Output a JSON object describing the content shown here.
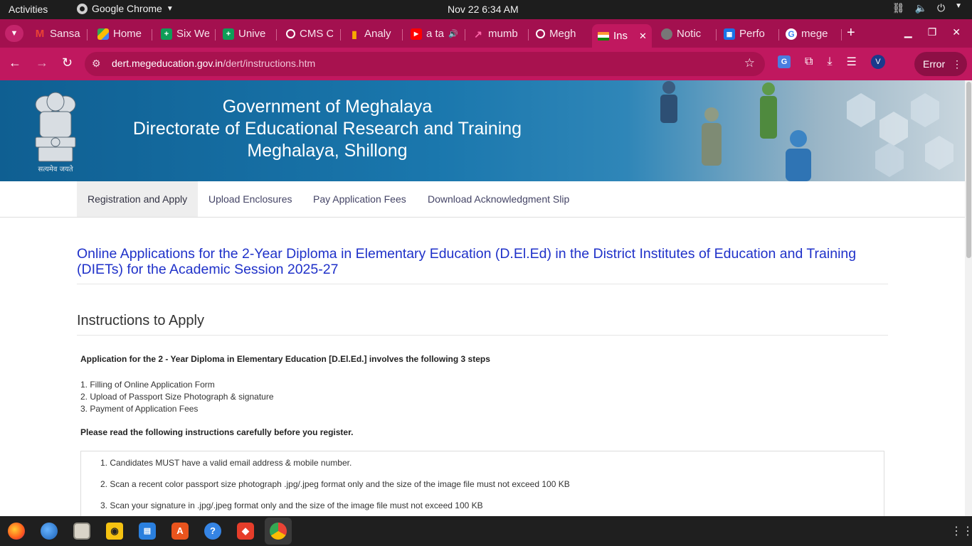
{
  "system_bar": {
    "activities": "Activities",
    "app_name": "Google Chrome",
    "clock": "Nov 22  6:34 AM"
  },
  "tabs": [
    {
      "label": "Sansa",
      "icon": "gmail-icon"
    },
    {
      "label": "Home",
      "icon": "drive-icon"
    },
    {
      "label": "Six We",
      "icon": "sheets-icon"
    },
    {
      "label": "Unive",
      "icon": "sheets-icon"
    },
    {
      "label": "CMS C",
      "icon": "loading-icon"
    },
    {
      "label": "Analy",
      "icon": "analytics-icon"
    },
    {
      "label": "a ta",
      "icon": "youtube-icon"
    },
    {
      "label": "mumb",
      "icon": "trend-icon"
    },
    {
      "label": "Megh",
      "icon": "loading-icon"
    },
    {
      "label": "Ins",
      "icon": "india-flag-icon",
      "active": true
    },
    {
      "label": "Notic",
      "icon": "globe-icon"
    },
    {
      "label": "Perfo",
      "icon": "store-icon"
    },
    {
      "label": "mege",
      "icon": "google-icon"
    }
  ],
  "address_bar": {
    "domain": "dert.megeducation.gov.in",
    "path": "/dert/instructions.htm",
    "error_label": "Error",
    "profile_letter": "V"
  },
  "banner": {
    "line1": "Government of Meghalaya",
    "line2": "Directorate of Educational Research and Training",
    "line3": "Meghalaya, Shillong",
    "emblem_motto": "सत्यमेव जयते"
  },
  "page_nav": [
    "Registration and Apply",
    "Upload Enclosures",
    "Pay Application Fees",
    "Download Acknowledgment Slip"
  ],
  "content": {
    "heading": "Online Applications for the 2-Year Diploma in Elementary Education (D.El.Ed) in the District Institutes of Education and Training (DIETs) for the Academic Session 2025-27",
    "subheading": "Instructions to Apply",
    "intro": "Application for the 2 - Year Diploma in Elementary Education [D.El.Ed.] involves the following 3 steps",
    "steps": [
      "1. Filling of Online Application Form",
      "2. Upload of Passport Size Photograph & signature",
      "3. Payment of Application Fees"
    ],
    "please_read": "Please read the following instructions carefully before you register.",
    "instructions": [
      "1. Candidates MUST have a valid email address & mobile number.",
      "2. Scan a recent color passport size photograph .jpg/.jpeg format only and the size of the image file must not exceed 100 KB",
      "3. Scan your signature in .jpg/.jpeg format only and the size of the image file must not exceed 100 KB"
    ]
  },
  "colors": {
    "chrome_theme": "#c0185f",
    "tabstrip": "#a3104f",
    "heading_blue": "#1f31c9"
  }
}
